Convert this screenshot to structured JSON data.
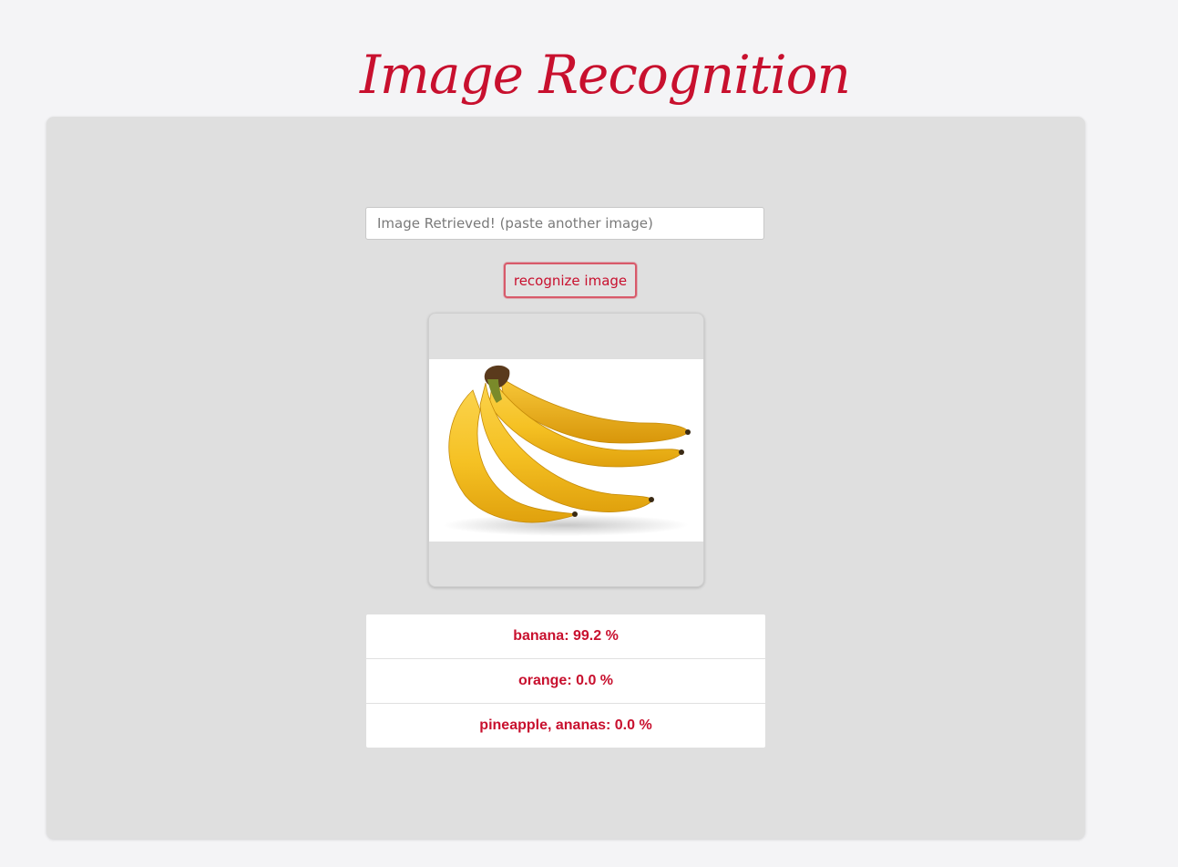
{
  "header": {
    "title": "Image Recognition"
  },
  "form": {
    "input_placeholder": "Image Retrieved! (paste another image)",
    "input_value": "",
    "button_label": "recognize image"
  },
  "preview": {
    "image_subject": "banana-bunch"
  },
  "results": [
    {
      "label": "banana: 99.2 %"
    },
    {
      "label": "orange: 0.0 %"
    },
    {
      "label": "pineapple, ananas: 0.0 %"
    }
  ],
  "colors": {
    "accent": "#c8102e",
    "page_background": "#f4f4f6",
    "panel_background": "#dfdfdf"
  }
}
